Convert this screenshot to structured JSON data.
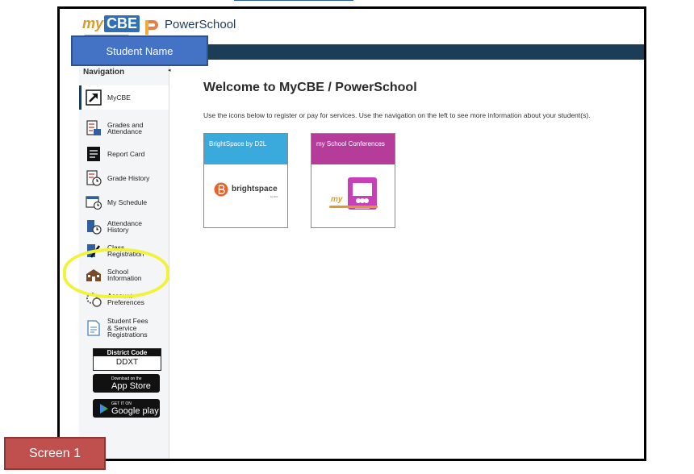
{
  "header": {
    "mycbe_logo": "my",
    "mycbe_logo_badge": "CBE",
    "powerschool_label": "PowerSchool",
    "student_name": "Student Name"
  },
  "sidebar": {
    "heading": "Navigation",
    "items": [
      {
        "label": "MyCBE",
        "icon": "external-link-icon",
        "active": true
      },
      {
        "label": "Grades and\nAttendance",
        "icon": "grades-icon"
      },
      {
        "label": "Report Card",
        "icon": "report-card-icon"
      },
      {
        "label": "Grade History",
        "icon": "grade-history-icon"
      },
      {
        "label": "My Schedule",
        "icon": "schedule-icon"
      },
      {
        "label": "Attendance\nHistory",
        "icon": "attendance-history-icon"
      },
      {
        "label": "Class\nRegistration",
        "icon": "class-registration-icon"
      },
      {
        "label": "School\nInformation",
        "icon": "school-icon"
      },
      {
        "label": "Account\nPreferences",
        "icon": "account-preferences-icon"
      },
      {
        "label": "Student Fees\n& Service\nRegistrations",
        "icon": "student-fees-icon"
      }
    ],
    "district": {
      "title": "District Code",
      "code": "DDXT"
    },
    "app_store": {
      "small": "Download on the",
      "big": "App Store"
    },
    "google_play": {
      "small": "GET IT ON",
      "big": "Google play"
    }
  },
  "main": {
    "title": "Welcome to MyCBE / PowerSchool",
    "intro": "Use the icons below to register or pay for services. Use the navigation on the left to see more information about your student(s).",
    "tiles": [
      {
        "title": "BrightSpace by D2L",
        "logo_text": "brightspace",
        "logo_sub": "by D2L",
        "color": "#3aa9dc"
      },
      {
        "title": "my School Conferences",
        "logo_text": "my",
        "color": "#b63c9a"
      }
    ]
  },
  "colors": {
    "nav_bar": "#1c3d57",
    "student_name_bg": "#4472c4",
    "screen_label_bg": "#c0504d",
    "highlight": "#f2f23a"
  },
  "screen_label": "Screen 1"
}
